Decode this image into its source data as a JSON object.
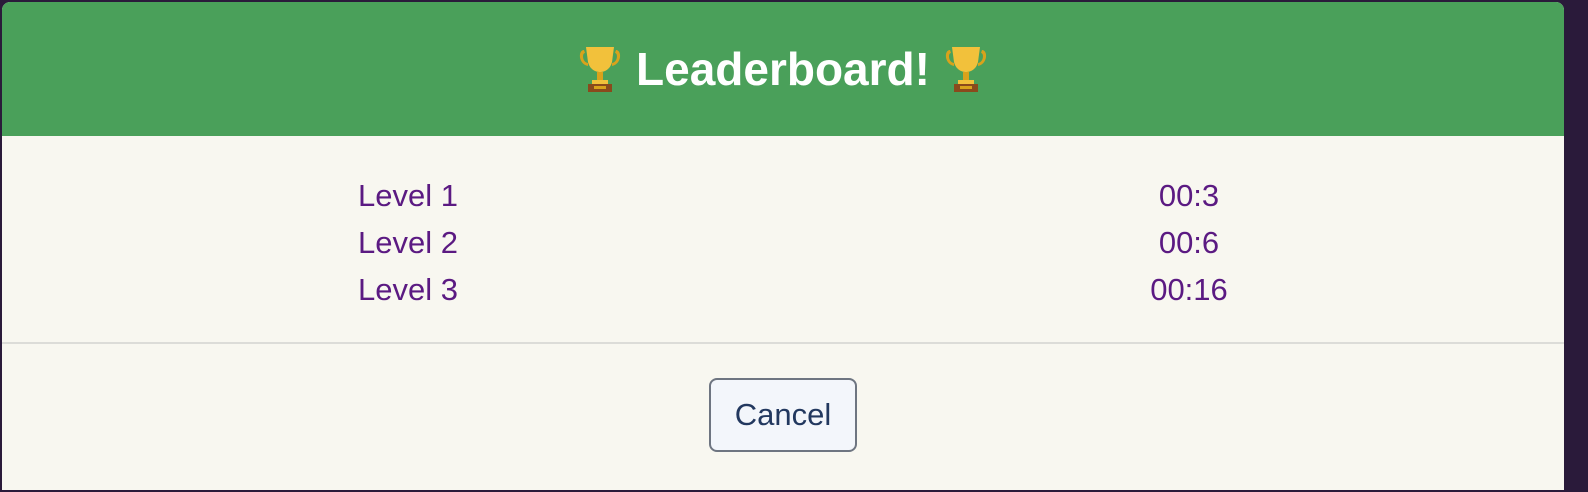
{
  "dialog": {
    "title": "Leaderboard!",
    "trophy_icon": "trophy-icon",
    "header_color": "#4aa05a",
    "text_color": "#5b1a82"
  },
  "scores": [
    {
      "level": "Level 1",
      "time": "00:3"
    },
    {
      "level": "Level 2",
      "time": "00:6"
    },
    {
      "level": "Level 3",
      "time": "00:16"
    }
  ],
  "footer": {
    "cancel_label": "Cancel"
  }
}
